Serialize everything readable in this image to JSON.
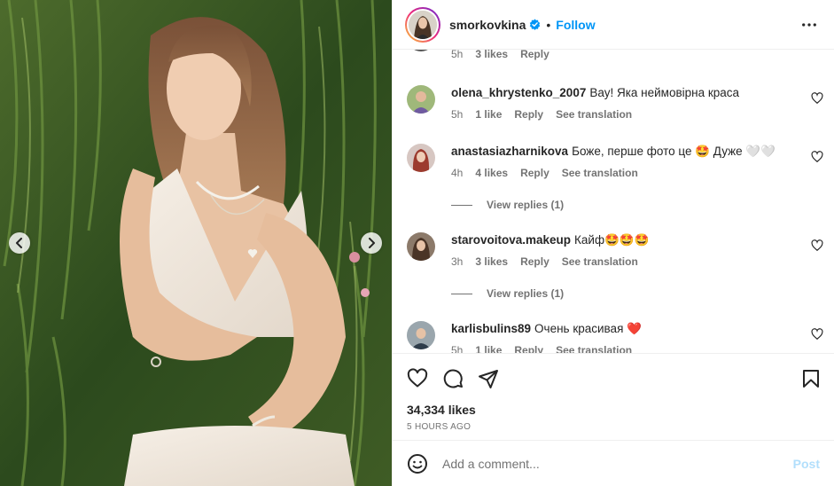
{
  "post": {
    "username": "smorkovkina",
    "verified": true,
    "separator": "•",
    "follow_label": "Follow",
    "more_icon": "more-horizontal-icon"
  },
  "carousel": {
    "prev_icon": "chevron-left-icon",
    "next_icon": "chevron-right-icon"
  },
  "partial_top_meta": {
    "time": "5h",
    "likes": "3 likes",
    "reply": "Reply"
  },
  "comments": [
    {
      "username": "olena_khrystenko_2007",
      "text": "Вау! Яка неймовірна краса",
      "time": "5h",
      "likes": "1 like",
      "reply": "Reply",
      "translate": "See translation",
      "view_replies": ""
    },
    {
      "username": "anastasiazharnikova",
      "text": "Боже, перше фото це 🤩 Дуже 🤍🤍",
      "time": "4h",
      "likes": "4 likes",
      "reply": "Reply",
      "translate": "See translation",
      "view_replies": "View replies (1)"
    },
    {
      "username": "starovoitova.makeup",
      "text": "Кайф🤩🤩🤩",
      "time": "3h",
      "likes": "3 likes",
      "reply": "Reply",
      "translate": "See translation",
      "view_replies": "View replies (1)"
    },
    {
      "username": "karlisbulins89",
      "text": "Очень красивая ❤️",
      "time": "5h",
      "likes": "1 like",
      "reply": "Reply",
      "translate": "See translation",
      "view_replies": ""
    }
  ],
  "stats": {
    "likes": "34,334 likes",
    "time_ago": "5 HOURS AGO"
  },
  "composer": {
    "placeholder": "Add a comment...",
    "post_label": "Post"
  },
  "colors": {
    "accent": "#0095f6",
    "post_disabled": "#b2dffc",
    "muted": "#737373",
    "text": "#262626",
    "heart_red": "#ed1c24"
  }
}
